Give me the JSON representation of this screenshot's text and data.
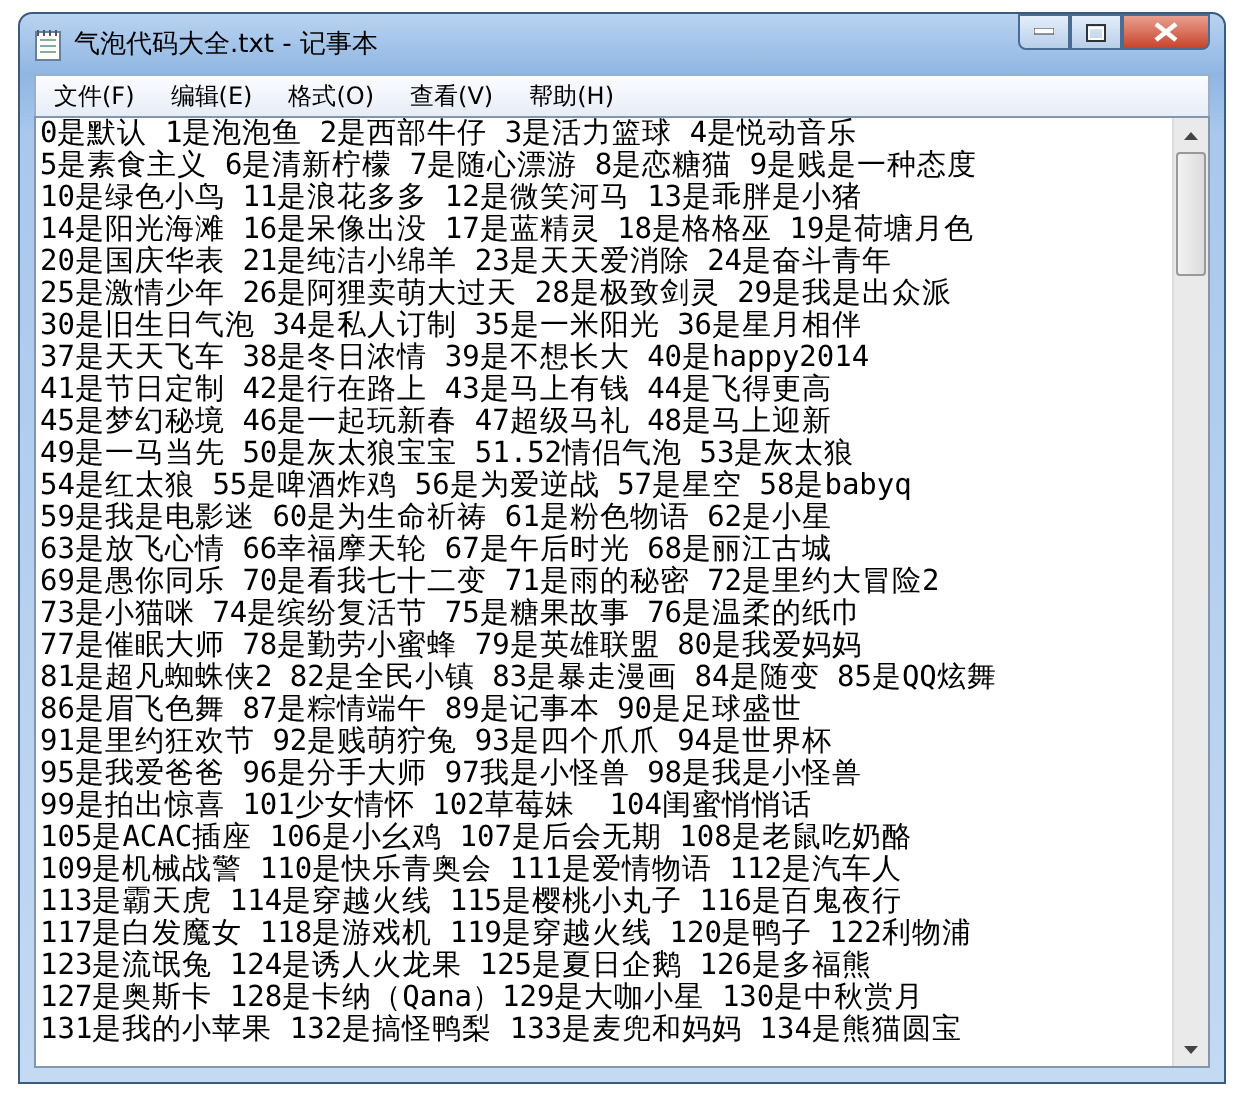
{
  "window": {
    "title": "气泡代码大全.txt - 记事本"
  },
  "menu": [
    {
      "label": "文件(F)"
    },
    {
      "label": "编辑(E)"
    },
    {
      "label": "格式(O)"
    },
    {
      "label": "查看(V)"
    },
    {
      "label": "帮助(H)"
    }
  ],
  "text_lines": [
    "0是默认 1是泡泡鱼 2是西部牛仔 3是活力篮球 4是悦动音乐",
    "5是素食主义 6是清新柠檬 7是随心漂游 8是恋糖猫 9是贱是一种态度",
    "10是绿色小鸟 11是浪花多多 12是微笑河马 13是乖胖是小猪",
    "14是阳光海滩 16是呆像出没 17是蓝精灵 18是格格巫 19是荷塘月色",
    "20是国庆华表 21是纯洁小绵羊 23是天天爱消除 24是奋斗青年",
    "25是激情少年 26是阿狸卖萌大过天 28是极致剑灵 29是我是出众派",
    "30是旧生日气泡 34是私人订制 35是一米阳光 36是星月相伴",
    "37是天天飞车 38是冬日浓情 39是不想长大 40是happy2014",
    "41是节日定制 42是行在路上 43是马上有钱 44是飞得更高",
    "45是梦幻秘境 46是一起玩新春 47超级马礼 48是马上迎新",
    "49是一马当先 50是灰太狼宝宝 51.52情侣气泡 53是灰太狼",
    "54是红太狼 55是啤酒炸鸡 56是为爱逆战 57是星空 58是babyq",
    "59是我是电影迷 60是为生命祈祷 61是粉色物语 62是小星",
    "63是放飞心情 66幸福摩天轮 67是午后时光 68是丽江古城",
    "69是愚你同乐 70是看我七十二变 71是雨的秘密 72是里约大冒险2",
    "73是小猫咪 74是缤纷复活节 75是糖果故事 76是温柔的纸巾",
    "77是催眠大师 78是勤劳小蜜蜂 79是英雄联盟 80是我爱妈妈",
    "81是超凡蜘蛛侠2 82是全民小镇 83是暴走漫画 84是随变 85是QQ炫舞",
    "86是眉飞色舞 87是粽情端午 89是记事本 90是足球盛世",
    "91是里约狂欢节 92是贱萌狞兔 93是四个爪爪 94是世界杯",
    "95是我爱爸爸 96是分手大师 97我是小怪兽 98是我是小怪兽",
    "99是拍出惊喜 101少女情怀 102草莓妹  104闺蜜悄悄话",
    "105是ACAC插座 106是小幺鸡 107是后会无期 108是老鼠吃奶酪",
    "109是机械战警 110是快乐青奥会 111是爱情物语 112是汽车人",
    "113是霸天虎 114是穿越火线 115是樱桃小丸子 116是百鬼夜行",
    "117是白发魔女 118是游戏机 119是穿越火线 120是鸭子 122利物浦",
    "123是流氓兔 124是诱人火龙果 125是夏日企鹅 126是多福熊",
    "127是奥斯卡 128是卡纳（Qana）129是大咖小星 130是中秋赏月",
    "131是我的小苹果 132是搞怪鸭梨 133是麦兜和妈妈 134是熊猫圆宝"
  ]
}
